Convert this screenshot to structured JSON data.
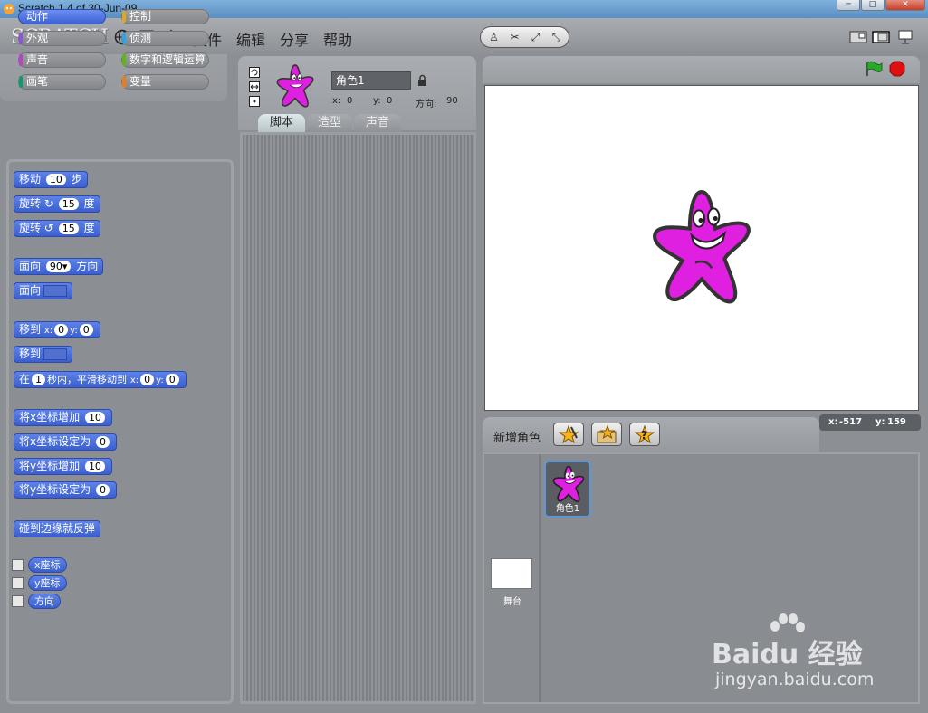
{
  "window": {
    "title": "Scratch 1.4 of 30-Jun-09",
    "min": "─",
    "max": "□",
    "close": "✕"
  },
  "menubar": {
    "logo": "SCRATCH",
    "items": [
      "文件",
      "编辑",
      "分享",
      "帮助"
    ]
  },
  "categories": [
    {
      "label": "动作",
      "color": "#4a6cd4"
    },
    {
      "label": "控制",
      "color": "#e1a91a"
    },
    {
      "label": "外观",
      "color": "#8a55d7"
    },
    {
      "label": "侦测",
      "color": "#2ca5e2"
    },
    {
      "label": "声音",
      "color": "#bb42c3"
    },
    {
      "label": "数字和逻辑运算",
      "color": "#5cb712"
    },
    {
      "label": "画笔",
      "color": "#0e9a6c"
    },
    {
      "label": "变量",
      "color": "#ee7d16"
    }
  ],
  "blocks": {
    "move": {
      "a": "移动",
      "n": "10",
      "b": "步"
    },
    "turn_cw": {
      "a": "旋转",
      "n": "15",
      "b": "度"
    },
    "turn_ccw": {
      "a": "旋转",
      "n": "15",
      "b": "度"
    },
    "point_dir": {
      "a": "面向",
      "n": "90▾",
      "b": "方向"
    },
    "point_toward": {
      "a": "面向"
    },
    "goto_xy": {
      "a": "移到",
      "xl": "x:",
      "x": "0",
      "yl": "y:",
      "y": "0"
    },
    "goto": {
      "a": "移到"
    },
    "glide": {
      "a": "在",
      "n": "1",
      "b": "秒内，平滑移动到",
      "xl": "x:",
      "x": "0",
      "yl": "y:",
      "y": "0"
    },
    "change_x": {
      "a": "将x坐标增加",
      "n": "10"
    },
    "set_x": {
      "a": "将x坐标设定为",
      "n": "0"
    },
    "change_y": {
      "a": "将y坐标增加",
      "n": "10"
    },
    "set_y": {
      "a": "将y坐标设定为",
      "n": "0"
    },
    "bounce": {
      "a": "碰到边缘就反弹"
    },
    "rep_x": "x座标",
    "rep_y": "y座标",
    "rep_dir": "方向"
  },
  "sprite": {
    "name": "角色1",
    "x_label": "x:",
    "x": "0",
    "y_label": "y:",
    "y": "0",
    "dir_label": "方向:",
    "dir": "90"
  },
  "tabs": [
    "脚本",
    "造型",
    "声音"
  ],
  "mouse": {
    "x_label": "x:",
    "x": "-517",
    "y_label": "y:",
    "y": "159"
  },
  "new_sprite_label": "新增角色",
  "sprite_thumb_label": "角色1",
  "stage_label": "舞台",
  "watermark": {
    "brand": "Bai",
    "suffix": "du 经验",
    "url": "jingyan.baidu.com"
  }
}
